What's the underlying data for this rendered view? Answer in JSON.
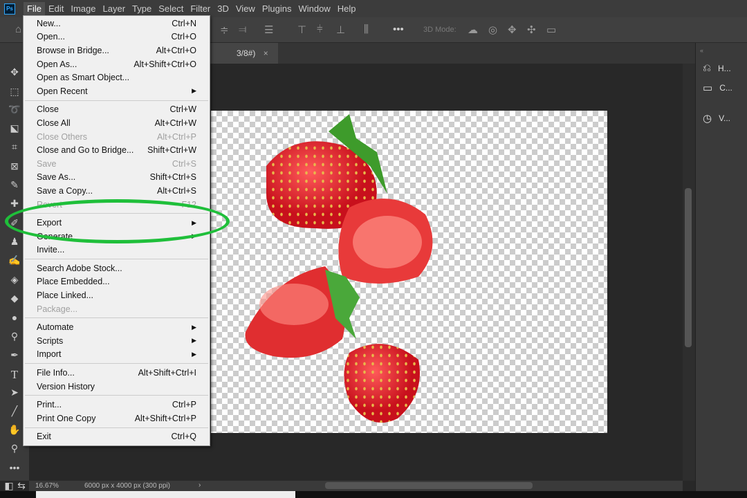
{
  "menubar": {
    "items": [
      "File",
      "Edit",
      "Image",
      "Layer",
      "Type",
      "Select",
      "Filter",
      "3D",
      "View",
      "Plugins",
      "Window",
      "Help"
    ],
    "active": "File"
  },
  "optbar": {
    "mode_label": "3D Mode:",
    "more": "•••"
  },
  "tab": {
    "title": "3/8#)",
    "close": "×"
  },
  "file_menu": {
    "groups": [
      [
        {
          "label": "New...",
          "shortcut": "Ctrl+N"
        },
        {
          "label": "Open...",
          "shortcut": "Ctrl+O"
        },
        {
          "label": "Browse in Bridge...",
          "shortcut": "Alt+Ctrl+O"
        },
        {
          "label": "Open As...",
          "shortcut": "Alt+Shift+Ctrl+O"
        },
        {
          "label": "Open as Smart Object...",
          "shortcut": ""
        },
        {
          "label": "Open Recent",
          "shortcut": "",
          "submenu": true
        }
      ],
      [
        {
          "label": "Close",
          "shortcut": "Ctrl+W"
        },
        {
          "label": "Close All",
          "shortcut": "Alt+Ctrl+W"
        },
        {
          "label": "Close Others",
          "shortcut": "Alt+Ctrl+P",
          "disabled": true
        },
        {
          "label": "Close and Go to Bridge...",
          "shortcut": "Shift+Ctrl+W"
        },
        {
          "label": "Save",
          "shortcut": "Ctrl+S",
          "disabled": true
        },
        {
          "label": "Save As...",
          "shortcut": "Shift+Ctrl+S"
        },
        {
          "label": "Save a Copy...",
          "shortcut": "Alt+Ctrl+S"
        },
        {
          "label": "Revert",
          "shortcut": "F12",
          "disabled": true
        }
      ],
      [
        {
          "label": "Export",
          "shortcut": "",
          "submenu": true
        },
        {
          "label": "Generate",
          "shortcut": "",
          "submenu": true
        },
        {
          "label": "Invite...",
          "shortcut": ""
        }
      ],
      [
        {
          "label": "Search Adobe Stock...",
          "shortcut": ""
        },
        {
          "label": "Place Embedded...",
          "shortcut": ""
        },
        {
          "label": "Place Linked...",
          "shortcut": ""
        },
        {
          "label": "Package...",
          "shortcut": "",
          "disabled": true
        }
      ],
      [
        {
          "label": "Automate",
          "shortcut": "",
          "submenu": true
        },
        {
          "label": "Scripts",
          "shortcut": "",
          "submenu": true
        },
        {
          "label": "Import",
          "shortcut": "",
          "submenu": true
        }
      ],
      [
        {
          "label": "File Info...",
          "shortcut": "Alt+Shift+Ctrl+I"
        },
        {
          "label": "Version History",
          "shortcut": ""
        }
      ],
      [
        {
          "label": "Print...",
          "shortcut": "Ctrl+P"
        },
        {
          "label": "Print One Copy",
          "shortcut": "Alt+Shift+Ctrl+P"
        }
      ],
      [
        {
          "label": "Exit",
          "shortcut": "Ctrl+Q"
        }
      ]
    ]
  },
  "highlight": {
    "color": "#1fbf3a",
    "target": "Export"
  },
  "right_panel": [
    {
      "icon": "history-icon",
      "label": "H..."
    },
    {
      "icon": "comment-icon",
      "label": "C..."
    },
    {
      "icon": "version-icon",
      "label": "V..."
    }
  ],
  "status": {
    "zoom": "16.67%",
    "doc_info": "6000 px x 4000 px (300 ppi)"
  }
}
